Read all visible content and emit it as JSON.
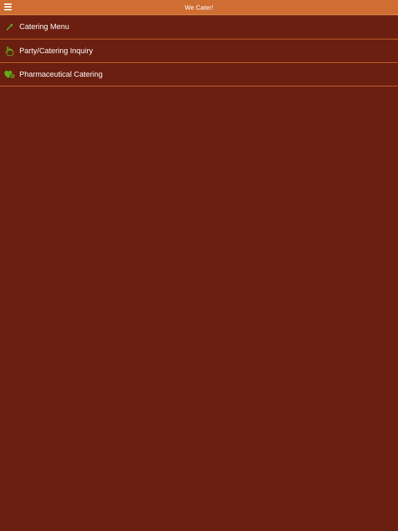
{
  "header": {
    "title": "We Cater!",
    "menu_icon": "hamburger-menu-icon"
  },
  "menu": {
    "items": [
      {
        "label": "Catering Menu",
        "icon": "spoon-icon"
      },
      {
        "label": "Party/Catering Inquiry",
        "icon": "hand-icon"
      },
      {
        "label": "Pharmaceutical Catering",
        "icon": "heart-plus-icon"
      }
    ]
  },
  "colors": {
    "header_background": "#cf6d33",
    "page_background": "#6b1f10",
    "divider": "#c96a2a",
    "icon_green": "#5fae1a",
    "text": "#ffffff"
  }
}
